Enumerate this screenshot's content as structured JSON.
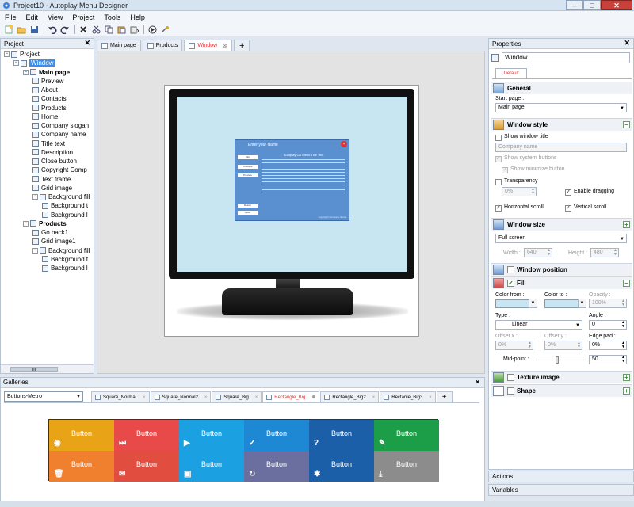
{
  "window": {
    "title": "Project10 - Autoplay Menu Designer",
    "min": "–",
    "max": "□",
    "close": "✕"
  },
  "menu": [
    "File",
    "Edit",
    "View",
    "Project",
    "Tools",
    "Help"
  ],
  "project_panel": {
    "title": "Project",
    "close": "✕",
    "nodes": [
      {
        "label": "Project",
        "depth": 0,
        "exp": "−"
      },
      {
        "label": "Window",
        "depth": 1,
        "exp": "−",
        "selected": true
      },
      {
        "label": "Main page",
        "depth": 2,
        "exp": "−",
        "bold": true
      },
      {
        "label": "Preview",
        "depth": 3
      },
      {
        "label": "About",
        "depth": 3
      },
      {
        "label": "Contacts",
        "depth": 3
      },
      {
        "label": "Products",
        "depth": 3
      },
      {
        "label": "Home",
        "depth": 3
      },
      {
        "label": "Company slogan",
        "depth": 3
      },
      {
        "label": "Company name",
        "depth": 3
      },
      {
        "label": "Title text",
        "depth": 3
      },
      {
        "label": "Description",
        "depth": 3
      },
      {
        "label": "Close button",
        "depth": 3
      },
      {
        "label": "Copyright Comp",
        "depth": 3
      },
      {
        "label": "Text frame",
        "depth": 3
      },
      {
        "label": "Grid image",
        "depth": 3
      },
      {
        "label": "Background fill",
        "depth": 3,
        "exp": "−"
      },
      {
        "label": "Background t",
        "depth": 4
      },
      {
        "label": "Background l",
        "depth": 4
      },
      {
        "label": "Products",
        "depth": 2,
        "exp": "−",
        "bold": true
      },
      {
        "label": "Go back1",
        "depth": 3
      },
      {
        "label": "Grid image1",
        "depth": 3
      },
      {
        "label": "Background fill",
        "depth": 3,
        "exp": "−"
      },
      {
        "label": "Background t",
        "depth": 4
      },
      {
        "label": "Background l",
        "depth": 4
      }
    ],
    "scroll_label": "III"
  },
  "doc_tabs": [
    {
      "label": "Main page",
      "active": false
    },
    {
      "label": "Products",
      "active": false
    },
    {
      "label": "Window",
      "active": true
    }
  ],
  "add_tab": "+",
  "preview": {
    "dialog_title": "Enter your Name",
    "dialog_heading": "Autoplay CD Menu Title Text",
    "buttons": [
      "Info",
      "Products",
      "Preview"
    ],
    "bottom_buttons": [
      "Return",
      "Close"
    ],
    "footer": "Copyright Company Name"
  },
  "properties": {
    "title": "Properties",
    "close": "✕",
    "object_name": "Window",
    "tab": "Default",
    "general": {
      "title": "General",
      "start_page_label": "Start page :",
      "start_page": "Main page"
    },
    "window_style": {
      "title": "Window style",
      "toggle": "−",
      "show_title": "Show window title",
      "title_placeholder": "Company name",
      "show_system": "Show system buttons",
      "show_minimize": "Show minimize button",
      "transparency": "Transparency",
      "transparency_value": "0%",
      "enable_dragging": "Enable dragging",
      "horizontal_scroll": "Horizontal scroll",
      "vertical_scroll": "Vertical scroll"
    },
    "window_size": {
      "title": "Window size",
      "toggle": "+",
      "mode": "Full screen",
      "width_label": "Width :",
      "width": "640",
      "height_label": "Height :",
      "height": "480"
    },
    "window_position": {
      "title": "Window position"
    },
    "fill": {
      "title": "Fill",
      "toggle": "−",
      "color_from": "Color from :",
      "color_to": "Color to :",
      "opacity": "Opacity :",
      "opacity_value": "100%",
      "type_label": "Type :",
      "type": "Linear",
      "angle_label": "Angle :",
      "angle": "0",
      "offset_x": "Offset x :",
      "offset_x_value": "0%",
      "offset_y": "Offset y :",
      "offset_y_value": "0%",
      "edge_pad": "Edge pad :",
      "edge_pad_value": "0%",
      "mid_point": "Mid-point :",
      "mid_point_value": "50",
      "color_from_hex": "#c8e6f2",
      "color_to_hex": "#c8e6f2"
    },
    "texture": {
      "title": "Texture image",
      "toggle": "+"
    },
    "shape": {
      "title": "Shape",
      "toggle": "+"
    }
  },
  "side_tabs": [
    "Actions",
    "Variables"
  ],
  "galleries": {
    "title": "Galleries",
    "close": "✕",
    "selected": "Buttons-Metro",
    "tabs": [
      {
        "label": "Square_Normal",
        "active": false
      },
      {
        "label": "Square_Normal2",
        "active": false
      },
      {
        "label": "Square_Big",
        "active": false
      },
      {
        "label": "Rectangle_Big",
        "active": true
      },
      {
        "label": "Rectangle_Big2",
        "active": false
      },
      {
        "label": "Rectanle_Big3",
        "active": false
      }
    ],
    "tiles": [
      {
        "label": "Button",
        "color": "#e8a317",
        "icon": "◉",
        "icon_name": "camera-icon"
      },
      {
        "label": "Button",
        "color": "#e84a4a",
        "icon": "⏭",
        "icon_name": "skip-forward-icon"
      },
      {
        "label": "Button",
        "color": "#1ba1e2",
        "icon": "▶",
        "icon_name": "play-icon"
      },
      {
        "label": "Button",
        "color": "#1e88d4",
        "icon": "✓",
        "icon_name": "check-icon"
      },
      {
        "label": "Button",
        "color": "#1b5fa8",
        "icon": "?",
        "icon_name": "help-icon"
      },
      {
        "label": "Button",
        "color": "#1b9e47",
        "icon": "✎",
        "icon_name": "pencil-icon"
      },
      {
        "label": "Button",
        "color": "#f07f2e",
        "icon": "🗑",
        "icon_name": "trash-icon"
      },
      {
        "label": "Button",
        "color": "#e14d3e",
        "icon": "✉",
        "icon_name": "mail-icon"
      },
      {
        "label": "Button",
        "color": "#1ba1e2",
        "icon": "▣",
        "icon_name": "save-icon"
      },
      {
        "label": "Button",
        "color": "#6a6fa0",
        "icon": "↻",
        "icon_name": "refresh-icon"
      },
      {
        "label": "Button",
        "color": "#1b5fa8",
        "icon": "✱",
        "icon_name": "star-icon"
      },
      {
        "label": "Button",
        "color": "#8c8c8c",
        "icon": "⤓",
        "icon_name": "download-icon"
      }
    ]
  }
}
